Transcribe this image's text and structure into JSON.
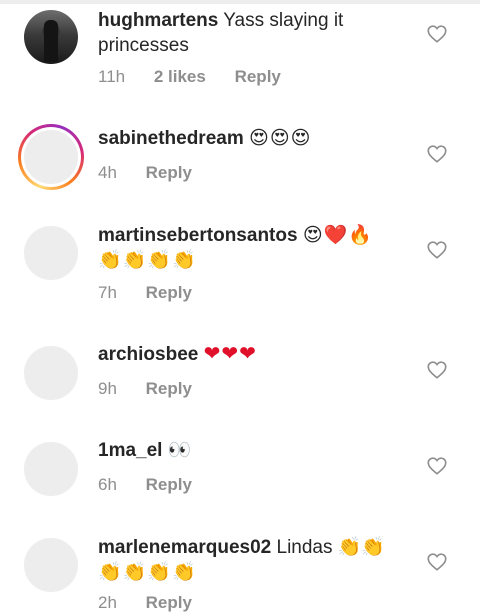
{
  "comments": [
    {
      "username": "hughmartens",
      "text": "Yass slaying it princesses",
      "time": "11h",
      "likes": "2 likes",
      "reply_label": "Reply",
      "avatar": "profile-photo",
      "story_ring": false
    },
    {
      "username": "sabinethedream",
      "text": "😍😍😍",
      "time": "4h",
      "reply_label": "Reply",
      "avatar": "empty",
      "story_ring": true
    },
    {
      "username": "martinsebertonsantos",
      "text": "😍❤️🔥",
      "text2": "👏👏👏👏",
      "time": "7h",
      "reply_label": "Reply",
      "avatar": "empty",
      "story_ring": false
    },
    {
      "username": "archiosbee",
      "text": "❤❤❤",
      "time": "9h",
      "reply_label": "Reply",
      "avatar": "empty",
      "story_ring": false
    },
    {
      "username": "1ma_el",
      "text": "👀",
      "time": "6h",
      "reply_label": "Reply",
      "avatar": "empty",
      "story_ring": false
    },
    {
      "username": "marlenemarques02",
      "text": "Lindas 👏👏",
      "text2": "👏👏👏👏",
      "time": "2h",
      "reply_label": "Reply",
      "avatar": "empty",
      "story_ring": false
    }
  ],
  "icons": {
    "like": "heart-outline-icon"
  },
  "colors": {
    "text": "#262626",
    "meta": "#8e8e8e",
    "avatar_placeholder": "#ededed",
    "heart": "#e0102a"
  }
}
